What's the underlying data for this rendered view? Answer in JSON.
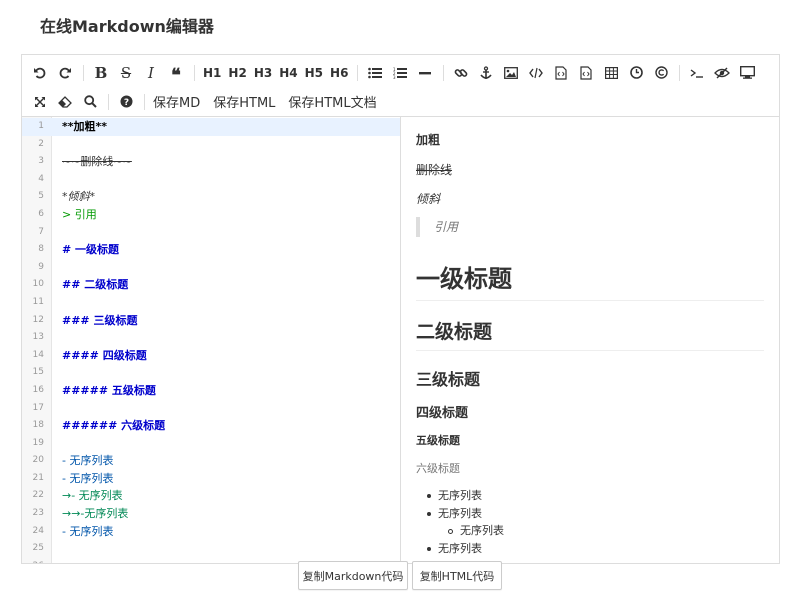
{
  "page": {
    "title": "在线Markdown编辑器"
  },
  "toolbar": {
    "h1": "H1",
    "h2": "H2",
    "h3": "H3",
    "h4": "H4",
    "h5": "H5",
    "h6": "H6",
    "save_md": "保存MD",
    "save_html": "保存HTML",
    "save_html_doc": "保存HTML文档",
    "icons": [
      "undo-icon",
      "redo-icon",
      "bold-icon",
      "strikethrough-icon",
      "italic-icon",
      "quote-icon",
      "unordered-list-icon",
      "ordered-list-icon",
      "horizontal-rule-icon",
      "link-icon",
      "anchor-icon",
      "image-icon",
      "code-icon",
      "code-block-icon",
      "code-file-icon",
      "table-icon",
      "datetime-icon",
      "copyright-icon",
      "terminal-icon",
      "preview-toggle-icon",
      "fullscreen-preview-icon",
      "fullscreen-icon",
      "eraser-icon",
      "search-icon",
      "help-icon"
    ]
  },
  "editor": {
    "lines": [
      {
        "n": "1",
        "text": "**加粗**"
      },
      {
        "n": "2",
        "text": ""
      },
      {
        "n": "3",
        "text": "~~删除线~~"
      },
      {
        "n": "4",
        "text": ""
      },
      {
        "n": "5",
        "text": "*倾斜*"
      },
      {
        "n": "6",
        "text": "> 引用"
      },
      {
        "n": "7",
        "text": ""
      },
      {
        "n": "8",
        "text": "# 一级标题"
      },
      {
        "n": "9",
        "text": ""
      },
      {
        "n": "10",
        "text": "## 二级标题"
      },
      {
        "n": "11",
        "text": ""
      },
      {
        "n": "12",
        "text": "### 三级标题"
      },
      {
        "n": "13",
        "text": ""
      },
      {
        "n": "14",
        "text": "#### 四级标题"
      },
      {
        "n": "15",
        "text": ""
      },
      {
        "n": "16",
        "text": "##### 五级标题"
      },
      {
        "n": "17",
        "text": ""
      },
      {
        "n": "18",
        "text": "###### 六级标题"
      },
      {
        "n": "19",
        "text": ""
      },
      {
        "n": "20",
        "text": "- 无序列表"
      },
      {
        "n": "21",
        "text": "- 无序列表"
      },
      {
        "n": "22",
        "text": "→- 无序列表"
      },
      {
        "n": "23",
        "text": "→→-无序列表"
      },
      {
        "n": "24",
        "text": "- 无序列表"
      },
      {
        "n": "25",
        "text": ""
      },
      {
        "n": "26",
        "text": ""
      }
    ]
  },
  "preview": {
    "bold": "加粗",
    "deleted": "删除线",
    "italic": "倾斜",
    "quote": "引用",
    "h1": "一级标题",
    "h2": "二级标题",
    "h3": "三级标题",
    "h4": "四级标题",
    "h5": "五级标题",
    "h6": "六级标题",
    "list": [
      "无序列表",
      "无序列表",
      "无序列表",
      "无序列表"
    ]
  },
  "footer": {
    "copy_markdown": "复制Markdown代码",
    "copy_html": "复制HTML代码"
  }
}
